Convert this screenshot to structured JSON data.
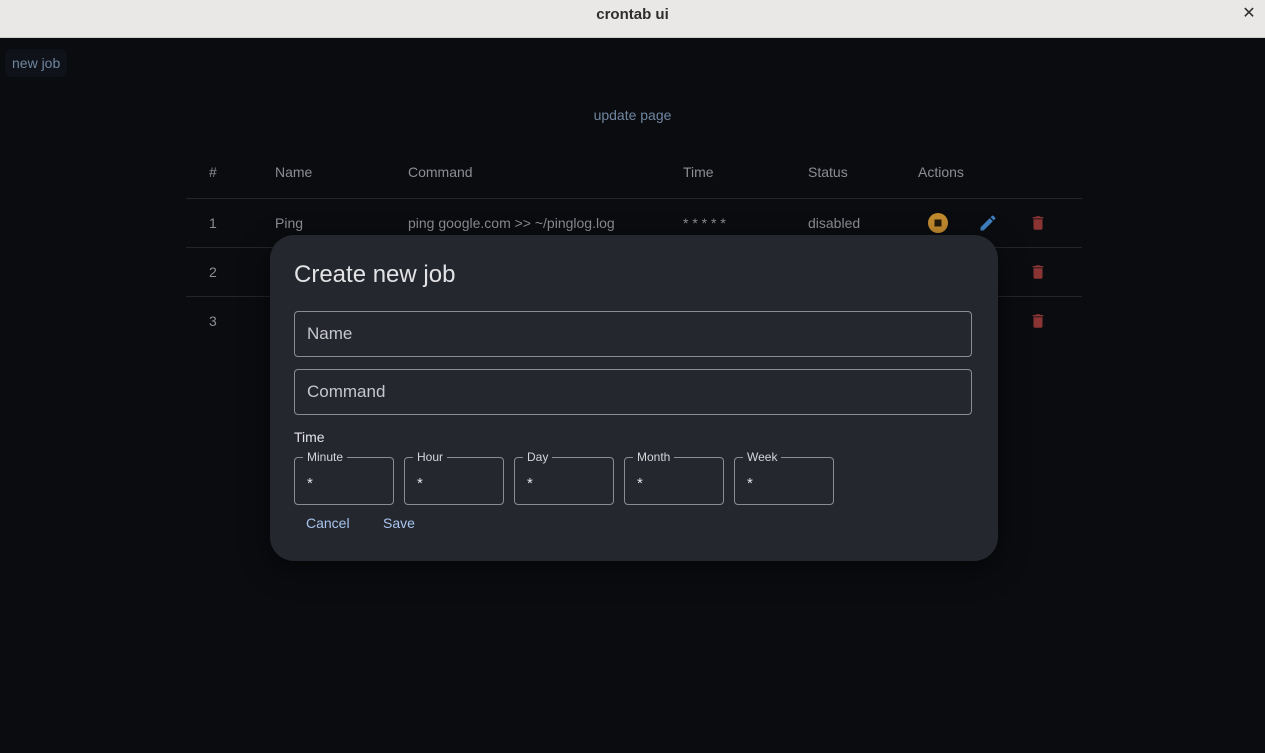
{
  "window": {
    "title": "crontab ui",
    "close_icon": "close-icon"
  },
  "toolbar": {
    "new_job_label": "new job",
    "update_page_label": "update page"
  },
  "table": {
    "headers": [
      "#",
      "Name",
      "Command",
      "Time",
      "Status",
      "Actions"
    ],
    "rows": [
      {
        "num": "1",
        "name": "Ping",
        "command": "ping google.com >> ~/pinglog.log",
        "time": "* * * * *",
        "status": "disabled"
      },
      {
        "num": "2",
        "name": "",
        "command": "",
        "time": "",
        "status": ""
      },
      {
        "num": "3",
        "name": "",
        "command": "",
        "time": "",
        "status": ""
      }
    ],
    "actions": {
      "stop_icon": "stop-circle-icon",
      "edit_icon": "pencil-icon",
      "delete_icon": "trash-icon"
    }
  },
  "colors": {
    "stop": "#c28a2e",
    "edit": "#3f7fbf",
    "delete": "#8a3434",
    "accent_link": "#a8c4ee"
  },
  "dialog": {
    "title": "Create new job",
    "name_placeholder": "Name",
    "command_placeholder": "Command",
    "time_label": "Time",
    "time_fields": [
      {
        "label": "Minute",
        "value": "*"
      },
      {
        "label": "Hour",
        "value": "*"
      },
      {
        "label": "Day",
        "value": "*"
      },
      {
        "label": "Month",
        "value": "*"
      },
      {
        "label": "Week",
        "value": "*"
      }
    ],
    "cancel_label": "Cancel",
    "save_label": "Save"
  }
}
